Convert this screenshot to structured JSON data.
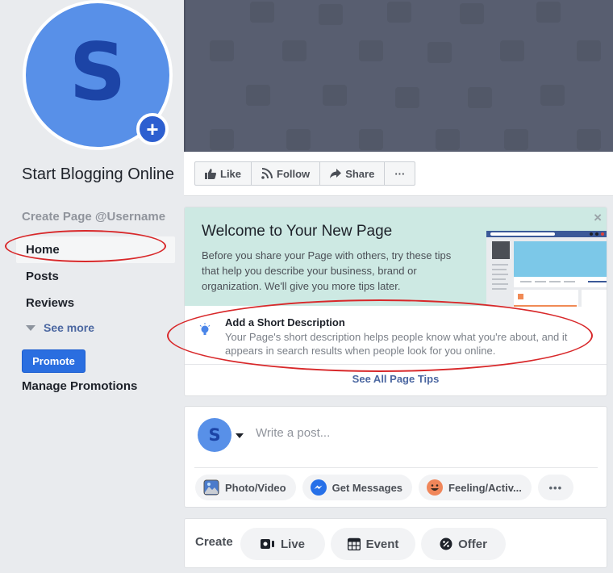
{
  "sidebar": {
    "avatar_letter": "S",
    "page_name": "Start Blogging Online",
    "username_link": "Create Page @Username",
    "nav_items": [
      {
        "label": "Home",
        "active": true
      },
      {
        "label": "Posts",
        "active": false
      },
      {
        "label": "Reviews",
        "active": false
      }
    ],
    "see_more": "See more",
    "promote_button": "Promote",
    "manage_promotions": "Manage Promotions"
  },
  "actions": {
    "like": "Like",
    "follow": "Follow",
    "share": "Share",
    "more": "···"
  },
  "welcome": {
    "title": "Welcome to Your New Page",
    "text": "Before you share your Page with others, try these tips that help you describe your business, brand or organization. We'll give you more tips later.",
    "close": "×",
    "tip": {
      "title": "Add a Short Description",
      "text": "Your Page's short description helps people know what you're about, and it appears in search results when people look for you online."
    },
    "see_all": "See All Page Tips"
  },
  "composer": {
    "avatar_letter": "S",
    "placeholder": "Write a post...",
    "actions": [
      "Photo/Video",
      "Get Messages",
      "Feeling/Activ...",
      "•••"
    ]
  },
  "create": {
    "label": "Create",
    "buttons": [
      "Live",
      "Event",
      "Offer"
    ]
  },
  "colors": {
    "brand_blue": "#2a6ee0",
    "link_blue": "#4b67a1",
    "annotation_red": "#d8282a",
    "welcome_bg": "#cde9e3",
    "cover_bg": "#585e70"
  }
}
